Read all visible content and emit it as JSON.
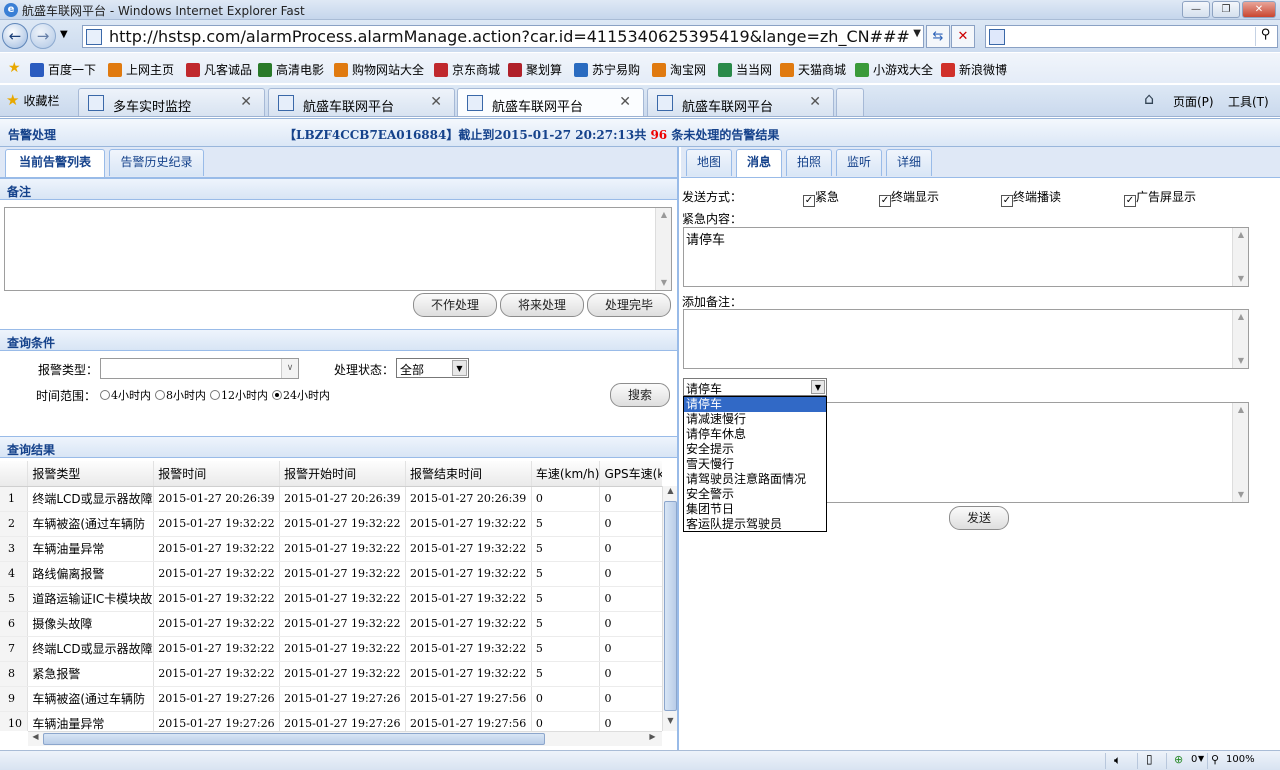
{
  "window": {
    "title": "航盛车联网平台 - Windows Internet Explorer Fast",
    "min": "—",
    "max": "❐",
    "close": "✕"
  },
  "address": {
    "url": "http://hstsp.com/alarmProcess.alarmManage.action?car.id=4115340625395419&lange=zh_CN###"
  },
  "links": [
    "百度一下",
    "上网主页",
    "凡客诚品",
    "高清电影",
    "购物网站大全",
    "京东商城",
    "聚划算",
    "苏宁易购",
    "淘宝网",
    "当当网",
    "天猫商城",
    "小游戏大全",
    "新浪微博"
  ],
  "favorites_label": "收藏栏",
  "browser_tabs": [
    "多车实时监控",
    "航盛车联网平台",
    "航盛车联网平台",
    "航盛车联网平台"
  ],
  "tools": {
    "home": "⌂",
    "page": "页面(P)",
    "tools": "工具(T)"
  },
  "header": {
    "title": "告警处理",
    "summary_pre": "【LBZF4CCB7EA016884】截止到2015-01-27 20:27:13共",
    "summary_count": "96",
    "summary_post": "条未处理的告警结果"
  },
  "left": {
    "tabs": [
      "当前告警列表",
      "告警历史纪录"
    ],
    "remarks_title": "备注",
    "buttons": [
      "不作处理",
      "将来处理",
      "处理完毕"
    ],
    "query_title": "查询条件",
    "alarm_type_label": "报警类型：",
    "status_label": "处理状态：",
    "status_value": "全部",
    "time_label": "时间范围：",
    "time_options": [
      "4小时内",
      "8小时内",
      "12小时内",
      "24小时内"
    ],
    "time_selected": 3,
    "search_button": "搜索",
    "results_title": "查询结果",
    "columns": [
      "报警类型",
      "报警时间",
      "报警开始时间",
      "报警结束时间",
      "车速(km/h)",
      "GPS车速(km/h)"
    ],
    "rows": [
      [
        "1",
        "终端LCD或显示器故障",
        "2015-01-27 20:26:39",
        "2015-01-27 20:26:39",
        "2015-01-27 20:26:39",
        "0",
        "0"
      ],
      [
        "2",
        "车辆被盗(通过车辆防",
        "2015-01-27 19:32:22",
        "2015-01-27 19:32:22",
        "2015-01-27 19:32:22",
        "5",
        "0"
      ],
      [
        "3",
        "车辆油量异常",
        "2015-01-27 19:32:22",
        "2015-01-27 19:32:22",
        "2015-01-27 19:32:22",
        "5",
        "0"
      ],
      [
        "4",
        "路线偏离报警",
        "2015-01-27 19:32:22",
        "2015-01-27 19:32:22",
        "2015-01-27 19:32:22",
        "5",
        "0"
      ],
      [
        "5",
        "道路运输证IC卡模块故",
        "2015-01-27 19:32:22",
        "2015-01-27 19:32:22",
        "2015-01-27 19:32:22",
        "5",
        "0"
      ],
      [
        "6",
        "摄像头故障",
        "2015-01-27 19:32:22",
        "2015-01-27 19:32:22",
        "2015-01-27 19:32:22",
        "5",
        "0"
      ],
      [
        "7",
        "终端LCD或显示器故障",
        "2015-01-27 19:32:22",
        "2015-01-27 19:32:22",
        "2015-01-27 19:32:22",
        "5",
        "0"
      ],
      [
        "8",
        "紧急报警",
        "2015-01-27 19:32:22",
        "2015-01-27 19:32:22",
        "2015-01-27 19:32:22",
        "5",
        "0"
      ],
      [
        "9",
        "车辆被盗(通过车辆防",
        "2015-01-27 19:27:26",
        "2015-01-27 19:27:26",
        "2015-01-27 19:27:56",
        "0",
        "0"
      ],
      [
        "10",
        "车辆油量异常",
        "2015-01-27 19:27:26",
        "2015-01-27 19:27:26",
        "2015-01-27 19:27:56",
        "0",
        "0"
      ]
    ]
  },
  "right": {
    "tabs": [
      "地图",
      "消息",
      "拍照",
      "监听",
      "详细"
    ],
    "active_tab": 1,
    "send_mode_label": "发送方式：",
    "send_modes": [
      "紧急",
      "终端显示",
      "终端播读",
      "广告屏显示"
    ],
    "urgent_label": "紧急内容：",
    "urgent_text": "请停车",
    "remark_label": "添加备注：",
    "select_value": "请停车",
    "dropdown_options": [
      "请停车",
      "请减速慢行",
      "请停车休息",
      "安全提示",
      "雪天慢行",
      "请驾驶员注意路面情况",
      "安全警示",
      "集团节日",
      "客运队提示驾驶员"
    ],
    "send_button": "发送"
  },
  "status": {
    "zone": "0",
    "zoom": "100%"
  }
}
